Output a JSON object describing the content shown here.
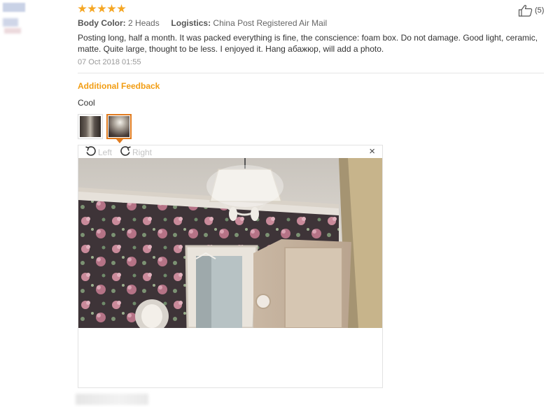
{
  "review": {
    "rating": 5,
    "like_count": "(5)",
    "body_color_label": "Body Color:",
    "body_color_value": "2 Heads",
    "logistics_label": "Logistics:",
    "logistics_value": "China Post Registered Air Mail",
    "text": "Posting long, half a month. It was packed everything is fine, the conscience: foam box. Do not damage. Good light, ceramic, matte. Quite large, thought to be less. I enjoyed it. Hang абажюр, will add a photo.",
    "date": "07 Oct 2018 01:55"
  },
  "additional": {
    "title": "Additional Feedback",
    "text": "Cool"
  },
  "viewer": {
    "rotate_left_label": "Left",
    "rotate_right_label": "Right",
    "close_symbol": "×"
  },
  "colors": {
    "accent": "#f29d13",
    "star": "#f5a623",
    "selected_thumb": "#e07b1f"
  }
}
